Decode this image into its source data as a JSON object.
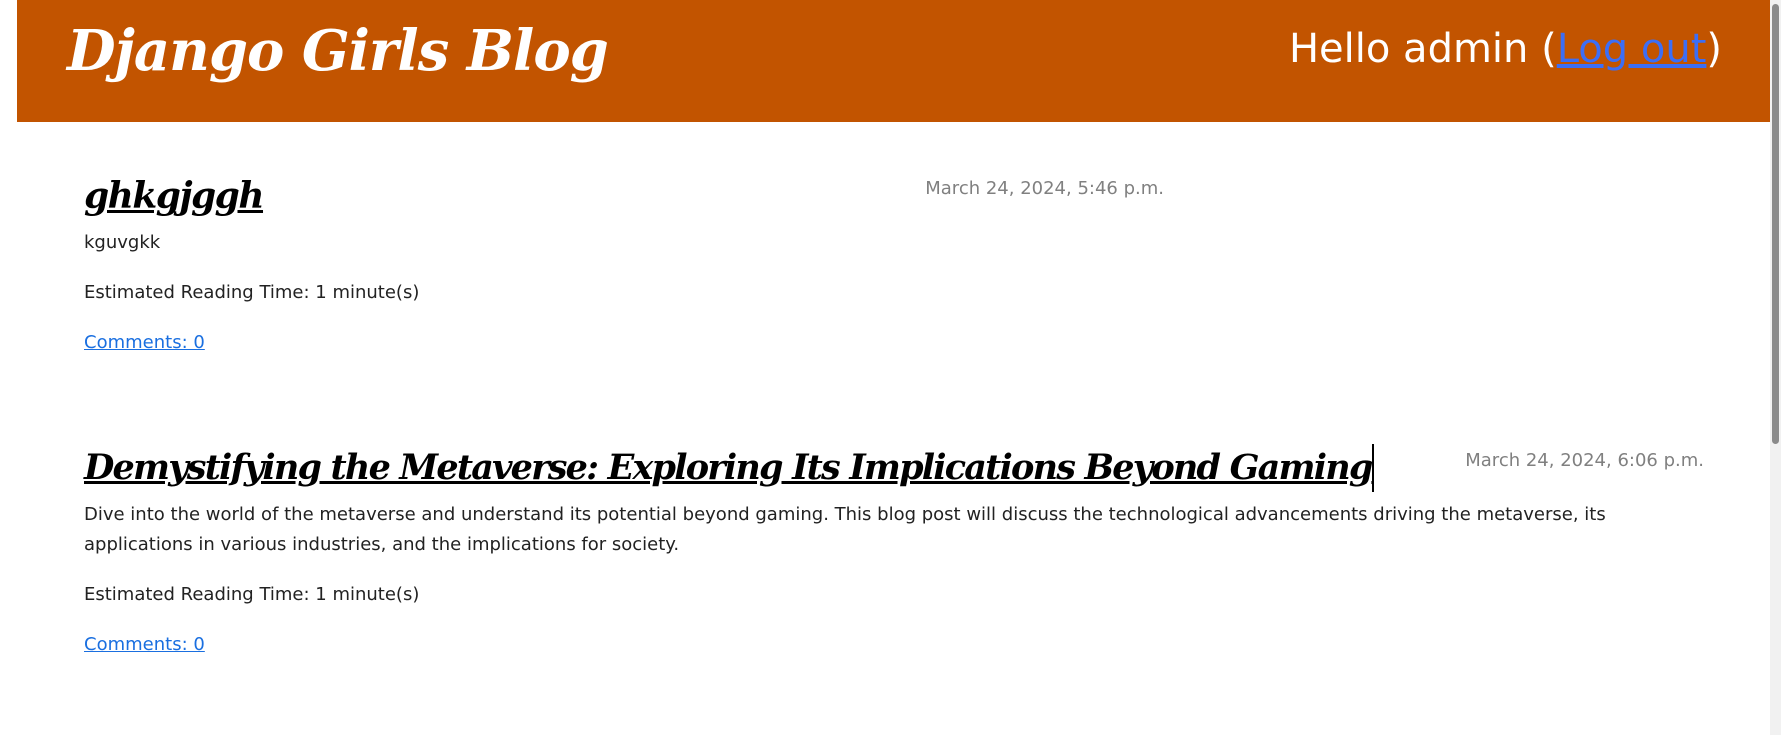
{
  "header": {
    "brand": "Django Girls Blog",
    "greeting_prefix": "Hello admin (",
    "logout_label": "Log out",
    "greeting_suffix": ")"
  },
  "posts": [
    {
      "title": "ghkgjggh",
      "date": "March 24, 2024, 5:46 p.m.",
      "body": "kguvgkk",
      "reading_time": "Estimated Reading Time: 1 minute(s)",
      "comments": "Comments: 0"
    },
    {
      "title": "Demystifying the Metaverse: Exploring Its Implications Beyond Gaming",
      "date": "March 24, 2024, 6:06 p.m.",
      "body": "Dive into the world of the metaverse and understand its potential beyond gaming. This blog post will discuss the technological advancements driving the metaverse, its applications in various industries, and the implications for society.",
      "reading_time": "Estimated Reading Time: 1 minute(s)",
      "comments": "Comments: 0"
    }
  ],
  "colors": {
    "header_bg": "#c25400",
    "link": "#1a6fe0",
    "date_text": "#808080"
  }
}
